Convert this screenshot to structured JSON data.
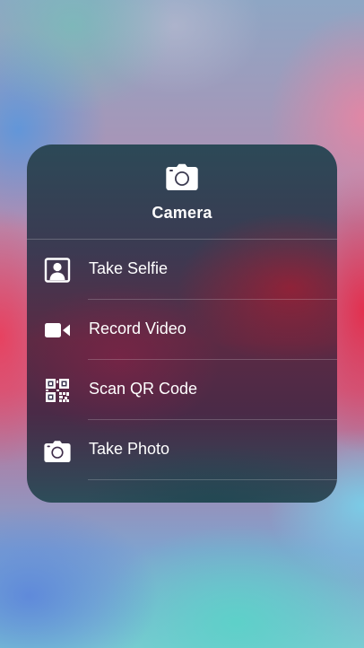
{
  "menu": {
    "title": "Camera",
    "header_icon": "camera-icon",
    "items": [
      {
        "label": "Take Selfie",
        "icon": "selfie-icon"
      },
      {
        "label": "Record Video",
        "icon": "video-camera-icon"
      },
      {
        "label": "Scan QR Code",
        "icon": "qr-code-icon"
      },
      {
        "label": "Take Photo",
        "icon": "camera-icon"
      }
    ]
  }
}
